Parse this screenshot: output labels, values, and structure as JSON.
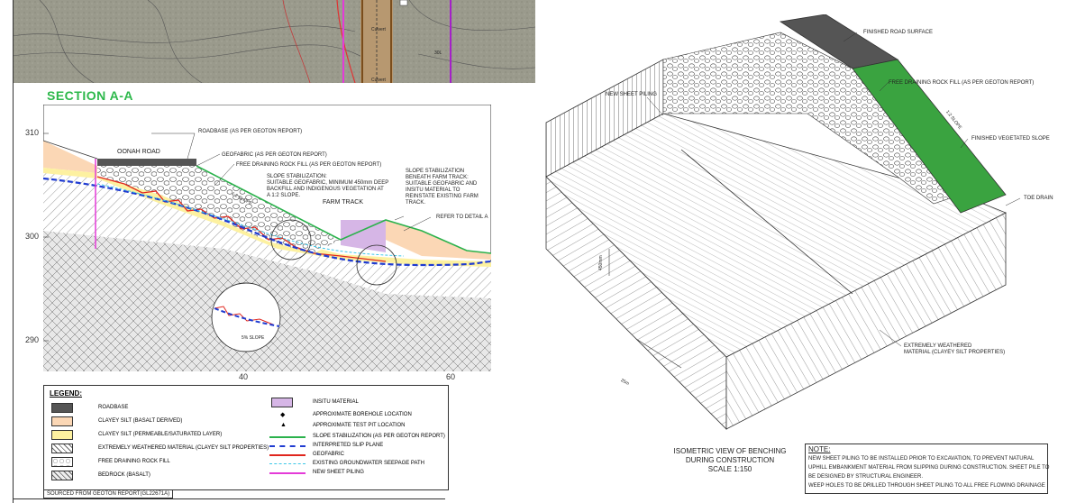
{
  "section": {
    "title": "SECTION A-A",
    "y_ticks": [
      "310",
      "300",
      "290"
    ],
    "x_ticks": [
      "40",
      "60"
    ],
    "labels": {
      "roadbase": "ROADBASE (AS PER GEOTON REPORT)",
      "oonah_road": "OONAH ROAD",
      "geofabric": "GEOFABRIC (AS PER GEOTON REPORT)",
      "free_draining": "FREE DRAINING ROCK FILL (AS PER GEOTON REPORT)",
      "slope_stab_1": "SLOPE STABILIZATION:",
      "slope_stab_2": "SUITABLE GEOFABRIC, MINIMUM 450mm DEEP",
      "slope_stab_3": "BACKFILL AND INDIGENOUS VEGETATION AT",
      "slope_stab_4": "A 1:2 SLOPE.",
      "beneath_1": "SLOPE STABILIZATION",
      "beneath_2": "BENEATH FARM TRACK:",
      "beneath_3": "SUITABLE GEOFABRIC AND",
      "beneath_4": "INSITU MATERIAL TO",
      "beneath_5": "REINSTATE EXISTING FARM",
      "beneath_6": "TRACK.",
      "farm_track": "FARM TRACK",
      "refer_detail": "REFER TO DETAIL A",
      "slope_ratio": "1:2 SLOPE",
      "detail_slope": "5% SLOPE"
    }
  },
  "legend": {
    "title": "LEGEND:",
    "left": [
      "ROADBASE",
      "CLAYEY SILT (BASALT DERIVED)",
      "CLAYEY SILT (PERMEABLE/SATURATED LAYER)",
      "EXTREMELY WEATHERED MATERIAL (CLAYEY SILT PROPERTIES)",
      "FREE DRAINING ROCK FILL",
      "BEDROCK (BASALT)"
    ],
    "right": [
      "INSITU MATERIAL",
      "APPROXIMATE BOREHOLE LOCATION",
      "APPROXIMATE TEST PIT LOCATION",
      "SLOPE STABILIZATION (AS PER GEOTON REPORT)",
      "INTERPRETED SLIP PLANE",
      "GEOFABRIC",
      "EXISTING GROUNDWATER SEEPAGE PATH",
      "NEW SHEET PILING"
    ]
  },
  "source": "SOURCED FROM GEOTON REPORT(GL22671A)",
  "iso": {
    "labels": {
      "finished_road": "FINISHED ROAD SURFACE",
      "free_draining": "FREE DRAINING ROCK FILL (AS PER GEOTON REPORT)",
      "new_sheet": "NEW SHEET PILING",
      "vegetated": "FINISHED VEGETATED SLOPE",
      "toe_drain": "TOE DRAIN",
      "weathered_1": "EXTREMELY WEATHERED",
      "weathered_2": "MATERIAL (CLAYEY SILT PROPERTIES)",
      "slope": "1:2 SLOPE",
      "dim_25": "25m",
      "dim_450": "450mm"
    },
    "title_1": "ISOMETRIC VIEW OF BENCHING",
    "title_2": "DURING CONSTRUCTION",
    "title_3": "SCALE 1:150"
  },
  "note": {
    "heading": "NOTE:",
    "lines": [
      "NEW SHEET PILING TO BE INSTALLED PRIOR TO EXCAVATION, TO PREVENT NATURAL",
      "UPHILL EMBANKMENT MATERIAL FROM SLIPPING DURING CONSTRUCTION. SHEET PILE TO",
      "BE DESIGNED BY STRUCTURAL ENGINEER.",
      "WEEP HOLES TO BE DRILLED THROUGH SHEET PILING TO ALL FREE FLOWING DRAINAGE"
    ]
  },
  "map": {
    "labels": [
      "Culvert",
      "Culvert",
      "30L"
    ]
  },
  "colors": {
    "green_title": "#2db84b",
    "roadbase": "#555555",
    "clayey_basalt": "#fbd7b5",
    "clayey_perm": "#fdf1a0",
    "insitu": "#d6b6e6",
    "vegetated": "#3aa340",
    "slip_plane": "#1f3bd1",
    "geofabric": "#e0261d",
    "seepage": "#3cc7e8",
    "sheet_piling": "#e43bd8",
    "slope_stab": "#2bb24c"
  }
}
